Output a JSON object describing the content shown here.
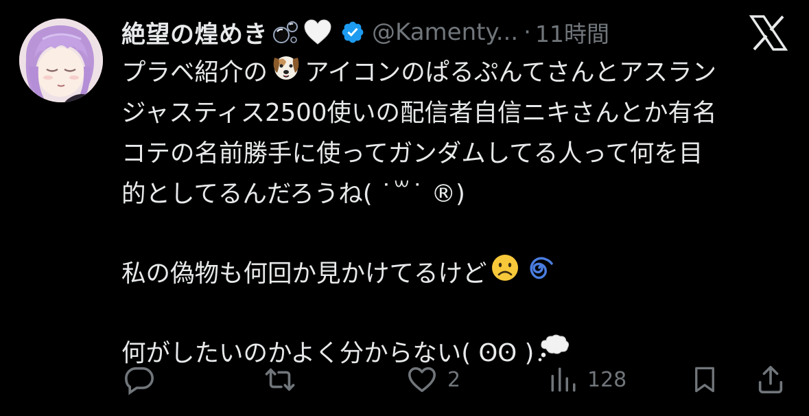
{
  "author": {
    "display_name": "絶望の煌めき",
    "name_emojis": [
      "bubbles-emoji",
      "white-heart-emoji"
    ],
    "verified": true,
    "handle": "@Kamenty...",
    "separator": "·",
    "timestamp": "11時間"
  },
  "platform_logo": "x-logo",
  "tweet": {
    "line1_a": "プラベ紹介の",
    "line1_emoji": "dog-face-emoji",
    "line1_b": "アイコンのぱるぷんてさんとアスラン",
    "line2": "ジャスティス2500使いの配信者自信ニキさんとか有名",
    "line3": "コテの名前勝手に使ってガンダムしてる人って何を目",
    "line4": "的としてるんだろうね( ˙꒳˙ ®)",
    "line5_a": "私の偽物も何回か見かけてるけど",
    "line5_emojis": [
      "frowning-face-emoji",
      "cyclone-emoji"
    ],
    "line6_a": "何がしたいのかよく分からない(  ʘʘ )",
    "line6_emoji": "thought-balloon-emoji"
  },
  "actions": {
    "reply": {
      "icon": "reply-icon",
      "count": ""
    },
    "retweet": {
      "icon": "retweet-icon",
      "count": ""
    },
    "like": {
      "icon": "heart-icon",
      "count": "2"
    },
    "views": {
      "icon": "views-icon",
      "count": "128"
    },
    "bookmark": {
      "icon": "bookmark-icon",
      "count": ""
    },
    "share": {
      "icon": "share-icon",
      "count": ""
    }
  },
  "colors": {
    "background": "#000000",
    "text": "#e7e9ea",
    "secondary": "#71767b",
    "verified_badge": "#1d9bf0"
  }
}
